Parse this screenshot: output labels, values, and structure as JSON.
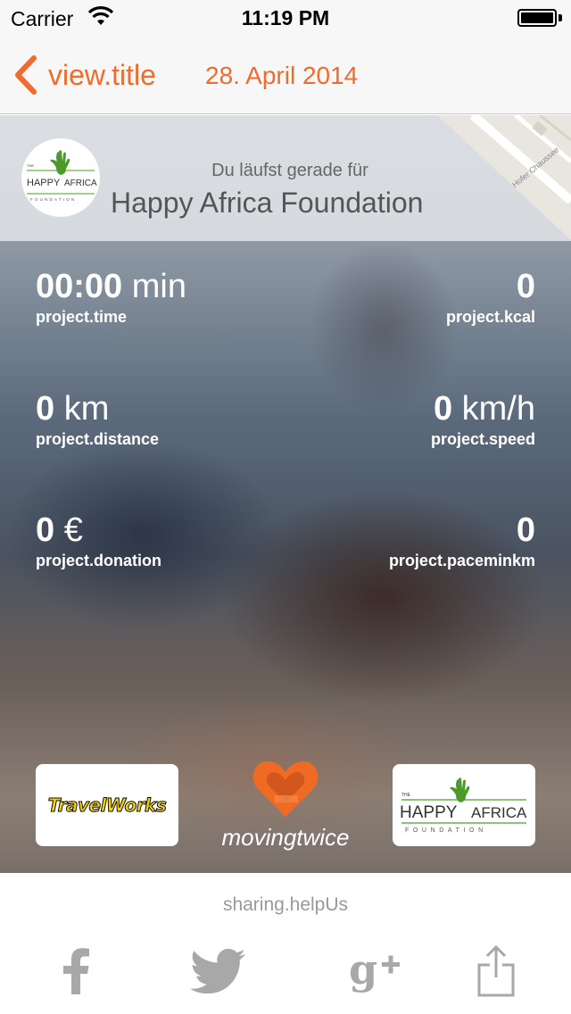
{
  "status_bar": {
    "carrier": "Carrier",
    "time": "11:19 PM"
  },
  "nav": {
    "back_label": "view.title",
    "date": "28. April 2014",
    "accent_color": "#f06b2c"
  },
  "header": {
    "running_for": "Du läufst gerade für",
    "organization": "Happy Africa Foundation"
  },
  "stats": {
    "time": {
      "value": "00:00",
      "unit": "min",
      "label": "project.time"
    },
    "kcal": {
      "value": "0",
      "label": "project.kcal"
    },
    "distance": {
      "value": "0",
      "unit": "km",
      "label": "project.distance"
    },
    "speed": {
      "value": "0",
      "unit": "km/h",
      "label": "project.speed"
    },
    "donation": {
      "value": "0",
      "unit": "€",
      "label": "project.donation"
    },
    "pace": {
      "value": "0",
      "label": "project.paceminkm"
    }
  },
  "sponsors": {
    "travelworks": "TravelWorks",
    "movingtwice": "movingtwice",
    "happyafrica_logo": {
      "the": "THE",
      "happy": "HAPPY",
      "africa": "AFRICA",
      "foundation": "FOUNDATION"
    }
  },
  "map": {
    "street": "Hofer Chaussee"
  },
  "sharing": {
    "text": "sharing.helpUs",
    "icons": [
      "facebook-icon",
      "twitter-icon",
      "google-plus-icon",
      "share-icon"
    ]
  }
}
